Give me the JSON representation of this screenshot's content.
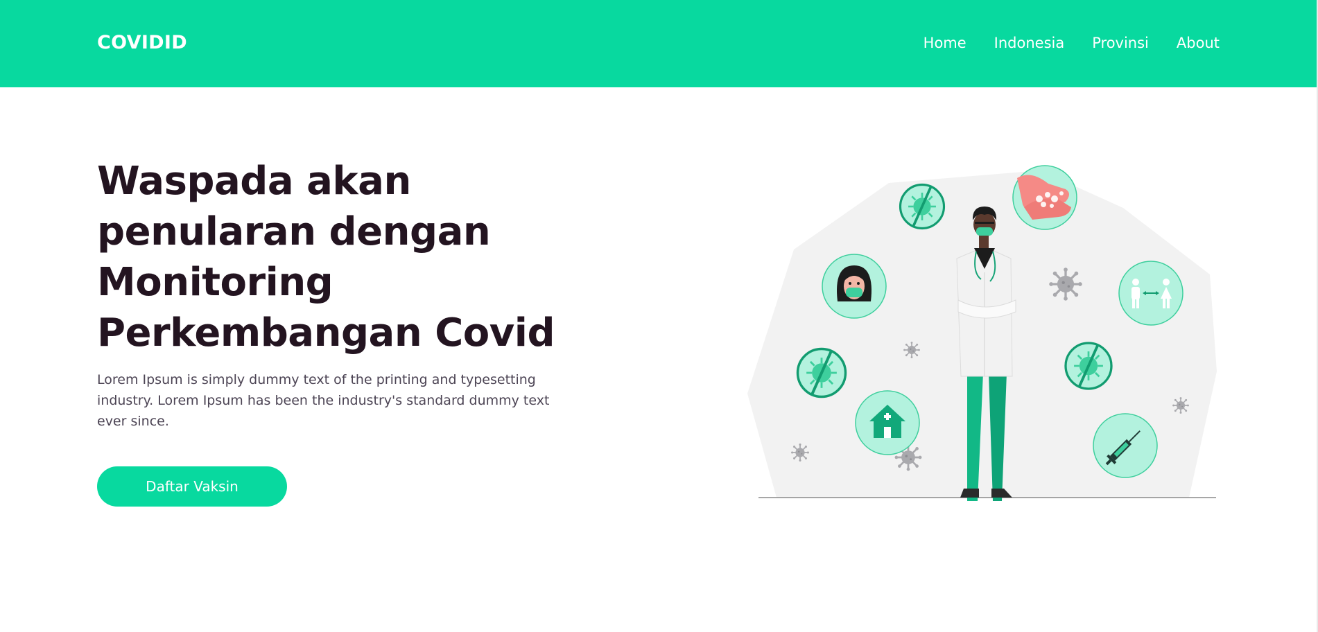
{
  "brand": "COVIDID",
  "nav": {
    "home": "Home",
    "indonesia": "Indonesia",
    "provinsi": "Provinsi",
    "about": "About"
  },
  "hero": {
    "title_lines": [
      "Waspada akan",
      "penularan dengan",
      "Monitoring",
      "Perkembangan Covid"
    ],
    "description_lines": [
      "Lorem Ipsum is simply dummy text of the printing and typesetting",
      "industry. Lorem Ipsum has been the industry's standard dummy text",
      "ever since."
    ],
    "cta_label": "Daftar Vaksin"
  },
  "colors": {
    "accent": "#08d99f",
    "title": "#231420",
    "body_text": "#4c4454"
  },
  "illustration": {
    "icons": [
      "hand-washing-icon",
      "no-virus-icon",
      "masked-woman-icon",
      "social-distancing-icon",
      "home-icon",
      "vaccine-syringe-icon",
      "doctor-figure",
      "virus-icon"
    ]
  }
}
